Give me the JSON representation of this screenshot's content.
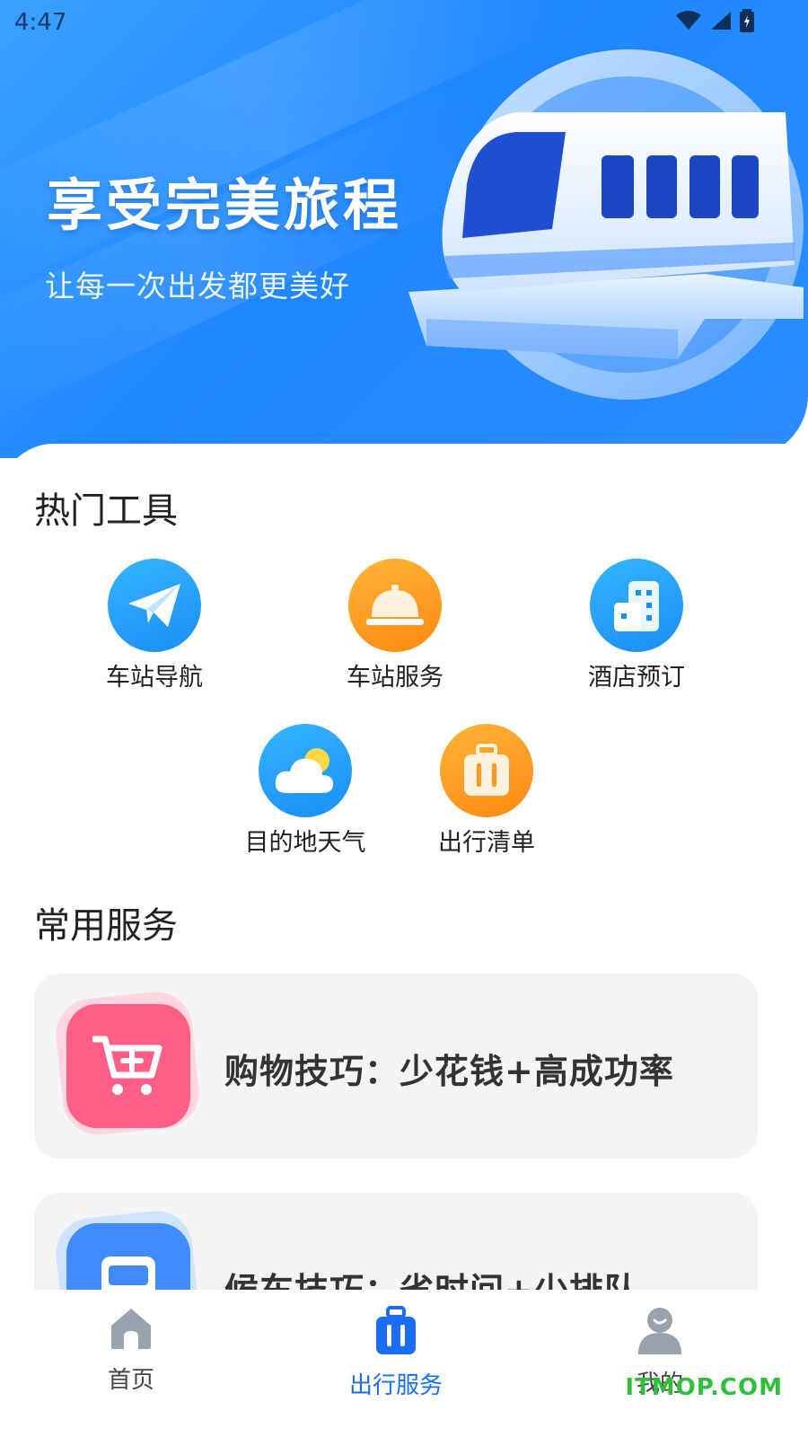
{
  "status": {
    "time": "4:47"
  },
  "hero": {
    "title": "享受完美旅程",
    "subtitle": "让每一次出发都更美好"
  },
  "hot_tools": {
    "title": "热门工具",
    "items": [
      {
        "label": "车站导航",
        "icon": "paper-plane-icon"
      },
      {
        "label": "车站服务",
        "icon": "service-bell-icon"
      },
      {
        "label": "酒店预订",
        "icon": "building-icon"
      },
      {
        "label": "目的地天气",
        "icon": "weather-icon"
      },
      {
        "label": "出行清单",
        "icon": "suitcase-icon"
      }
    ]
  },
  "common_services": {
    "title": "常用服务",
    "cards": [
      {
        "text": "购物技巧：少花钱+高成功率",
        "icon": "shopping-cart-icon",
        "color": "#ff5f86"
      },
      {
        "text": "候车技巧：省时间+少排队",
        "icon": "bus-icon",
        "color": "#3f8bff"
      }
    ]
  },
  "tabbar": {
    "tabs": [
      {
        "label": "首页",
        "icon": "home-icon"
      },
      {
        "label": "出行服务",
        "icon": "luggage-icon",
        "active": true
      },
      {
        "label": "我的",
        "icon": "profile-icon"
      }
    ]
  },
  "watermark": "ITMOP.COM",
  "colors": {
    "accent": "#1a6ef5",
    "hero_blue": "#1f87ff",
    "card_bg": "#f4f4f4"
  }
}
